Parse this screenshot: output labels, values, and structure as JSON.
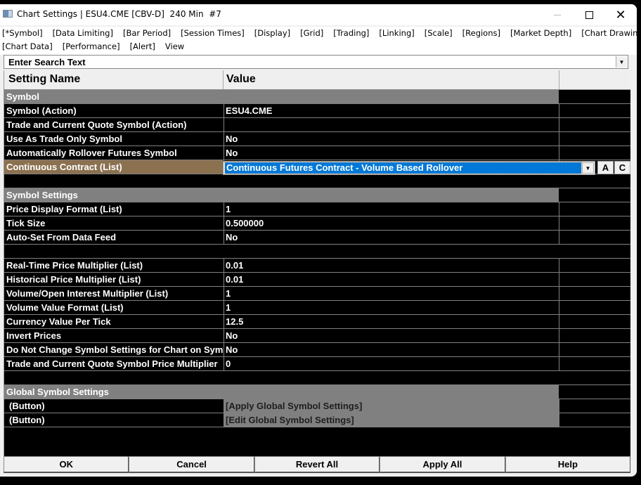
{
  "window": {
    "title": "Chart Settings | ESU4.CME [CBV-D]  240 Min  #7",
    "controls": {
      "minimize": "minimize",
      "maximize": "maximize",
      "close": "✕"
    }
  },
  "menu": {
    "row1": [
      "[*Symbol]",
      "[Data Limiting]",
      "[Bar Period]",
      "[Session Times]",
      "[Display]",
      "[Grid]",
      "[Trading]",
      "[Linking]",
      "[Scale]",
      "[Regions]",
      "[Market Depth]",
      "[Chart Drawings]"
    ],
    "row2": [
      "[Chart Data]",
      "[Performance]",
      "[Alert]",
      "View"
    ]
  },
  "search": {
    "placeholder": "Enter Search Text",
    "dropdown_icon": "▼"
  },
  "table": {
    "headers": {
      "name": "Setting Name",
      "value": "Value"
    },
    "rows": [
      {
        "type": "section",
        "name": "Symbol",
        "value": ""
      },
      {
        "type": "item",
        "name": "Symbol (Action)",
        "value": "ESU4.CME"
      },
      {
        "type": "item",
        "name": "Trade and Current Quote Symbol (Action)",
        "value": ""
      },
      {
        "type": "item",
        "name": "Use As Trade Only Symbol",
        "value": "No"
      },
      {
        "type": "item",
        "name": "Automatically Rollover Futures Symbol",
        "value": "No"
      },
      {
        "type": "highlight",
        "name": "Continuous Contract (List)",
        "value": "Continuous Futures Contract - Volume Based Rollover"
      },
      {
        "type": "blank",
        "name": "",
        "value": ""
      },
      {
        "type": "section",
        "name": "Symbol Settings",
        "value": ""
      },
      {
        "type": "item",
        "name": "Price Display Format (List)",
        "value": "1"
      },
      {
        "type": "item",
        "name": "Tick Size",
        "value": "0.500000"
      },
      {
        "type": "item",
        "name": "Auto-Set From Data Feed",
        "value": "No"
      },
      {
        "type": "blank",
        "name": "",
        "value": ""
      },
      {
        "type": "item",
        "name": "Real-Time Price Multiplier (List)",
        "value": "0.01"
      },
      {
        "type": "item",
        "name": "Historical Price Multiplier (List)",
        "value": "0.01"
      },
      {
        "type": "item",
        "name": "Volume/Open Interest Multiplier (List)",
        "value": "1"
      },
      {
        "type": "item",
        "name": "Volume Value Format (List)",
        "value": "1"
      },
      {
        "type": "item",
        "name": "Currency Value Per Tick",
        "value": "12.5"
      },
      {
        "type": "item",
        "name": "Invert Prices",
        "value": "No"
      },
      {
        "type": "item",
        "name": "Do Not Change Symbol Settings for Chart on Symbol Change",
        "value": "No"
      },
      {
        "type": "item",
        "name": "Trade and Current Quote Symbol Price Multiplier",
        "value": "0"
      },
      {
        "type": "blank",
        "name": "",
        "value": ""
      },
      {
        "type": "section",
        "name": "Global Symbol Settings",
        "value": ""
      },
      {
        "type": "btnrow",
        "name": "(Button)",
        "value": "[Apply Global Symbol Settings]"
      },
      {
        "type": "btnrow",
        "name": "(Button)",
        "value": "[Edit Global Symbol Settings]"
      }
    ],
    "combo_dropdown_icon": "▼",
    "combo_side_buttons": [
      "A",
      "C"
    ]
  },
  "footer": {
    "buttons": [
      "OK",
      "Cancel",
      "Revert All",
      "Apply All",
      "Help"
    ]
  },
  "colors": {
    "section_bg": "#808080",
    "highlight_bg": "#8b7150",
    "selection_bg": "#0078d7",
    "grid_bg": "#000000"
  }
}
